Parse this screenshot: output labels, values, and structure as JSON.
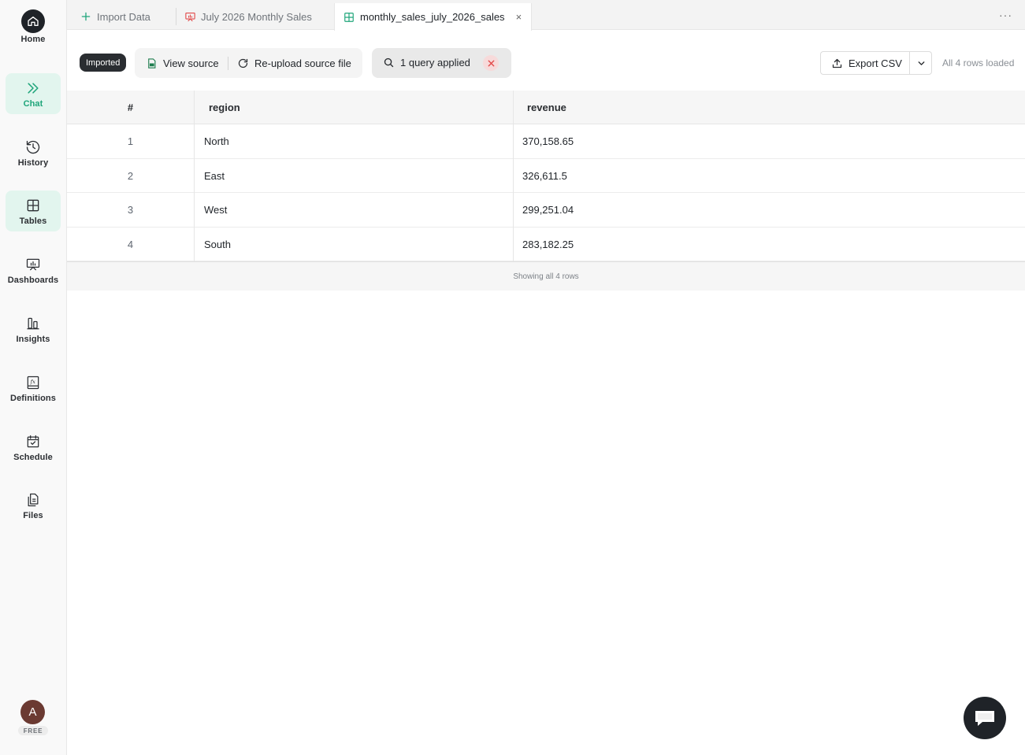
{
  "sidebar": {
    "items": [
      {
        "label": "Home",
        "icon": "home-icon"
      },
      {
        "label": "Chat",
        "icon": "chevrons-right-icon"
      },
      {
        "label": "History",
        "icon": "history-icon"
      },
      {
        "label": "Tables",
        "icon": "table-grid-icon"
      },
      {
        "label": "Dashboards",
        "icon": "presentation-chart-icon"
      },
      {
        "label": "Insights",
        "icon": "bar-columns-icon"
      },
      {
        "label": "Definitions",
        "icon": "formula-book-icon"
      },
      {
        "label": "Schedule",
        "icon": "calendar-check-icon"
      },
      {
        "label": "Files",
        "icon": "files-icon"
      }
    ],
    "user": {
      "initial": "A",
      "plan": "FREE"
    }
  },
  "tabs": [
    {
      "label": "Import Data",
      "icon": "plus-icon"
    },
    {
      "label": "July 2026 Monthly Sales",
      "icon": "dashboard-icon"
    },
    {
      "label": "monthly_sales_july_2026_sales",
      "icon": "table-icon",
      "close": "×"
    }
  ],
  "more_menu": "···",
  "toolbar": {
    "imported_badge": "Imported",
    "view_source": "View source",
    "reupload": "Re-upload source file",
    "query_applied": "1 query applied",
    "export_csv": "Export CSV",
    "rows_loaded": "All 4 rows loaded"
  },
  "table": {
    "columns": [
      "#",
      "region",
      "revenue"
    ],
    "rows": [
      {
        "n": "1",
        "region": "North",
        "revenue": "370,158.65"
      },
      {
        "n": "2",
        "region": "East",
        "revenue": "326,611.5"
      },
      {
        "n": "3",
        "region": "West",
        "revenue": "299,251.04"
      },
      {
        "n": "4",
        "region": "South",
        "revenue": "283,182.25"
      }
    ],
    "footer": "Showing all 4 rows"
  },
  "colors": {
    "accent": "#1ea57a",
    "active_bg": "#e2f5ee",
    "dark": "#1f2328",
    "danger": "#e24a4a"
  }
}
